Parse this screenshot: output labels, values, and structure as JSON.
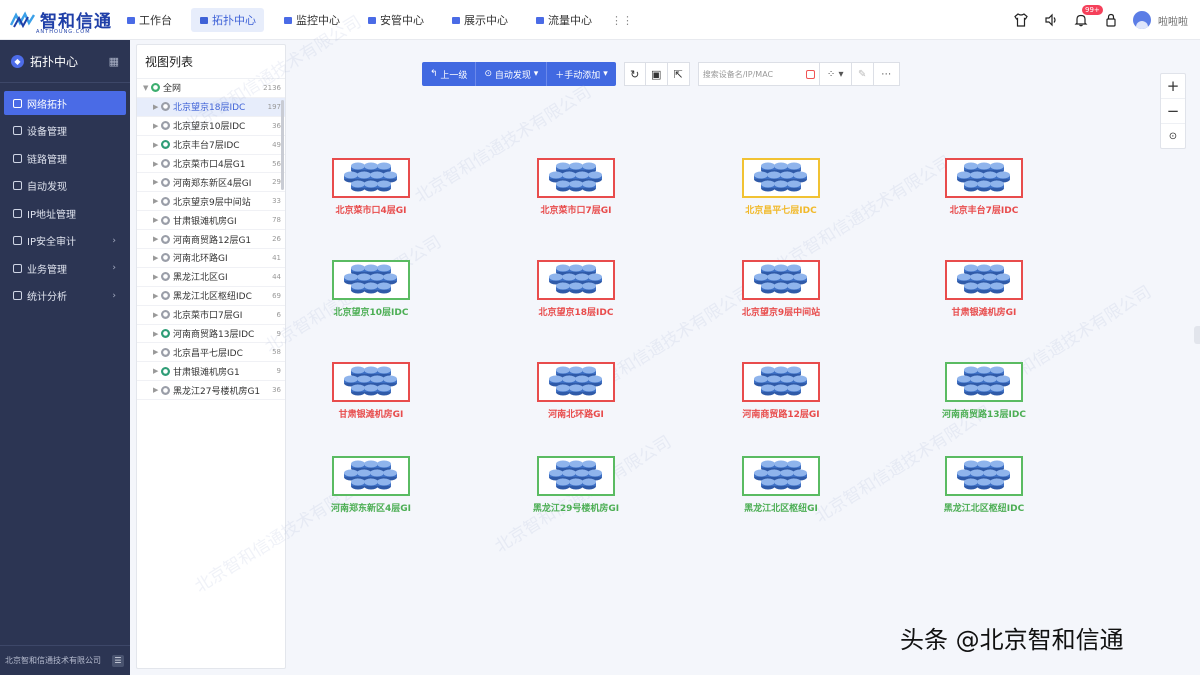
{
  "header": {
    "logo_text": "智和信通",
    "logo_sub": "ANTHOUNG.COM",
    "nav": [
      {
        "label": "工作台",
        "icon": "home-icon",
        "active": false
      },
      {
        "label": "拓扑中心",
        "icon": "topology-icon",
        "active": true
      },
      {
        "label": "监控中心",
        "icon": "monitor-icon",
        "active": false
      },
      {
        "label": "安管中心",
        "icon": "shield-icon",
        "active": false
      },
      {
        "label": "展示中心",
        "icon": "display-icon",
        "active": false
      },
      {
        "label": "流量中心",
        "icon": "flow-icon",
        "active": false
      }
    ],
    "notification_badge": "99+",
    "username": "啦啦啦"
  },
  "sidebar": {
    "title": "拓扑中心",
    "items": [
      {
        "label": "网络拓扑",
        "active": true,
        "has_arrow": false
      },
      {
        "label": "设备管理",
        "active": false,
        "has_arrow": false
      },
      {
        "label": "链路管理",
        "active": false,
        "has_arrow": false
      },
      {
        "label": "自动发现",
        "active": false,
        "has_arrow": false
      },
      {
        "label": "IP地址管理",
        "active": false,
        "has_arrow": false
      },
      {
        "label": "IP安全审计",
        "active": false,
        "has_arrow": true
      },
      {
        "label": "业务管理",
        "active": false,
        "has_arrow": true
      },
      {
        "label": "统计分析",
        "active": false,
        "has_arrow": true
      }
    ],
    "footer": "北京智和信通技术有限公司"
  },
  "viewlist": {
    "title": "视图列表",
    "root": {
      "label": "全网",
      "count": "2136"
    },
    "rows": [
      {
        "label": "北京望京18层IDC",
        "count": "197",
        "dot": "gray",
        "selected": true
      },
      {
        "label": "北京望京10层IDC",
        "count": "36",
        "dot": "gray",
        "selected": false
      },
      {
        "label": "北京丰台7层IDC",
        "count": "49",
        "dot": "teal",
        "selected": false
      },
      {
        "label": "北京菜市口4层G1",
        "count": "56",
        "dot": "gray",
        "selected": false
      },
      {
        "label": "河南郑东新区4层GI",
        "count": "29",
        "dot": "gray",
        "selected": false
      },
      {
        "label": "北京望京9层中间站",
        "count": "33",
        "dot": "gray",
        "selected": false
      },
      {
        "label": "甘肃银滩机房GI",
        "count": "78",
        "dot": "gray",
        "selected": false
      },
      {
        "label": "河南商贸路12层G1",
        "count": "26",
        "dot": "gray",
        "selected": false
      },
      {
        "label": "河南北环路GI",
        "count": "41",
        "dot": "gray",
        "selected": false
      },
      {
        "label": "黑龙江北区GI",
        "count": "44",
        "dot": "gray",
        "selected": false
      },
      {
        "label": "黑龙江北区枢纽IDC",
        "count": "69",
        "dot": "gray",
        "selected": false
      },
      {
        "label": "北京菜市口7层GI",
        "count": "6",
        "dot": "gray",
        "selected": false
      },
      {
        "label": "河南商贸路13层IDC",
        "count": "9",
        "dot": "teal",
        "selected": false
      },
      {
        "label": "北京昌平七层IDC",
        "count": "58",
        "dot": "gray",
        "selected": false
      },
      {
        "label": "甘肃银滩机房G1",
        "count": "9",
        "dot": "teal",
        "selected": false
      },
      {
        "label": "黑龙江27号楼机房G1",
        "count": "36",
        "dot": "gray",
        "selected": false
      }
    ]
  },
  "toolbar": {
    "up_label": "上一级",
    "discover_label": "自动发现",
    "manual_add_label": "手动添加",
    "search_placeholder": "搜索设备名/IP/MAC"
  },
  "nodes": [
    {
      "label": "北京菜市口4层GI",
      "status": "red"
    },
    {
      "label": "北京菜市口7层GI",
      "status": "red"
    },
    {
      "label": "北京昌平七层IDC",
      "status": "yellow"
    },
    {
      "label": "北京丰台7层IDC",
      "status": "red"
    },
    {
      "label": "北京望京10层IDC",
      "status": "green"
    },
    {
      "label": "北京望京18层IDC",
      "status": "red"
    },
    {
      "label": "北京望京9层中间站",
      "status": "red"
    },
    {
      "label": "甘肃银滩机房GI",
      "status": "red"
    },
    {
      "label": "甘肃银滩机房GI",
      "status": "red"
    },
    {
      "label": "河南北环路GI",
      "status": "red"
    },
    {
      "label": "河南商贸路12层GI",
      "status": "red"
    },
    {
      "label": "河南商贸路13层IDC",
      "status": "green"
    },
    {
      "label": "河南郑东新区4层GI",
      "status": "green"
    },
    {
      "label": "黑龙江29号楼机房GI",
      "status": "green"
    },
    {
      "label": "黑龙江北区枢纽GI",
      "status": "green"
    },
    {
      "label": "黑龙江北区枢纽IDC",
      "status": "green"
    }
  ],
  "watermark": "北京智和信通技术有限公司",
  "footer_mark": "头条 @北京智和信通"
}
